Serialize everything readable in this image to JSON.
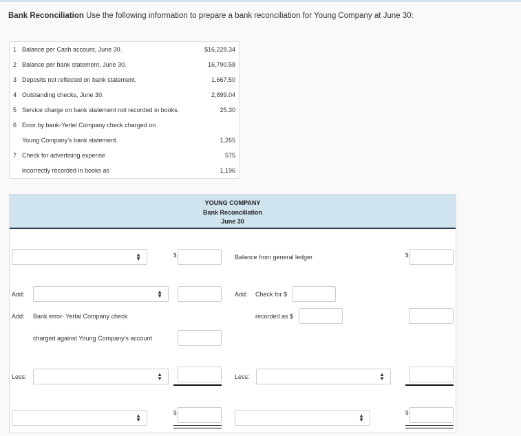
{
  "header": {
    "title_bold": "Bank Reconciliation",
    "title_rest": " Use the following information to prepare a bank reconciliation for Young Company at June 30:"
  },
  "info": [
    {
      "n": "1",
      "t": "Balance per Cash account, June 30.",
      "v": "$16,228.34"
    },
    {
      "n": "2",
      "t": "Balance per bank statement, June 30.",
      "v": "16,790.58"
    },
    {
      "n": "3",
      "t": "Deposits not reflected on bank statement.",
      "v": "1,667.50"
    },
    {
      "n": "4",
      "t": "Outstanding checks, June 30.",
      "v": "2,899.04"
    },
    {
      "n": "5",
      "t": "Service charge on bank statement not recorded in books.",
      "v": "25.30"
    },
    {
      "n": "6",
      "t": "Error by bank-Yertel Company check charged on",
      "v": ""
    },
    {
      "n": "",
      "t": "Young Company's bank statement.",
      "v": "1,265"
    },
    {
      "n": "7",
      "t": "Check for advertising expense",
      "v": "575"
    },
    {
      "n": "",
      "t": "incorrectly recorded in books as",
      "v": "1,196"
    }
  ],
  "recon": {
    "company": "YOUNG COMPANY",
    "title": "Bank Reconciliation",
    "date": "June 30",
    "balance_gl": "Balance from general ledger",
    "add": "Add:",
    "less": "Less:",
    "dollar": "$",
    "bank_error_1": "Bank error- Yertal Company check",
    "bank_error_2": "charged against Young Company's account",
    "check_for": "Check for $",
    "recorded_as": "recorded as $"
  }
}
